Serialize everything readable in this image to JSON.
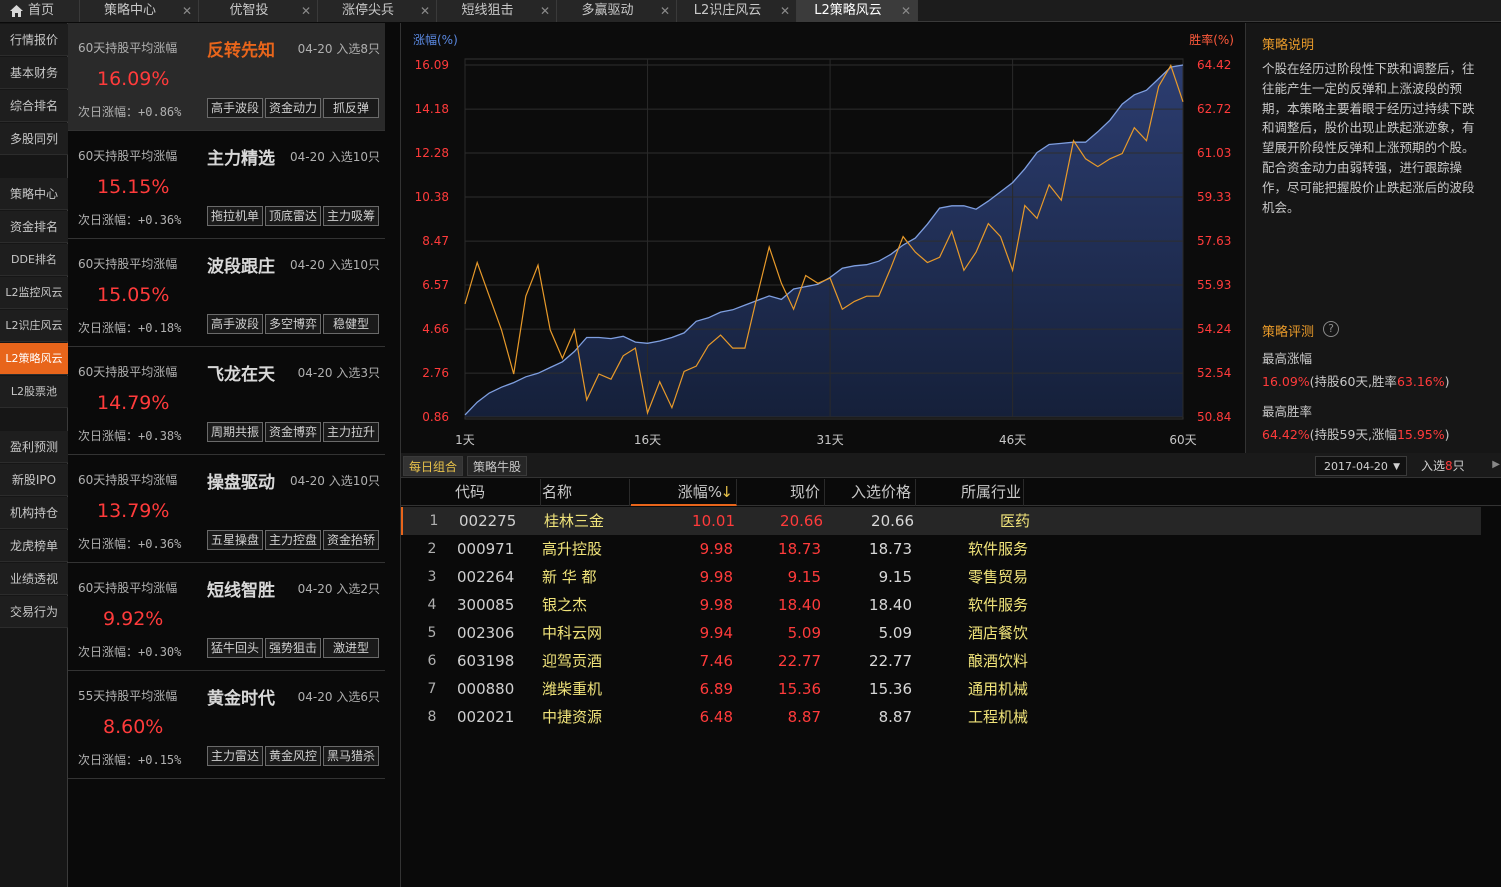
{
  "tabs": [
    {
      "label": "首页",
      "closable": false,
      "active": false
    },
    {
      "label": "策略中心",
      "closable": true,
      "active": false
    },
    {
      "label": "优智投",
      "closable": true,
      "active": false
    },
    {
      "label": "涨停尖兵",
      "closable": true,
      "active": false
    },
    {
      "label": "短线狙击",
      "closable": true,
      "active": false
    },
    {
      "label": "多赢驱动",
      "closable": true,
      "active": false
    },
    {
      "label": "L2识庄风云",
      "closable": true,
      "active": false
    },
    {
      "label": "L2策略风云",
      "closable": true,
      "active": true
    }
  ],
  "close_glyph": "✕",
  "leftnav": [
    {
      "label": "行情报价"
    },
    {
      "label": "基本财务"
    },
    {
      "label": "综合排名"
    },
    {
      "label": "多股同列"
    },
    {
      "label": "策略中心"
    },
    {
      "label": "资金排名"
    },
    {
      "label": "DDE排名"
    },
    {
      "label": "L2监控风云"
    },
    {
      "label": "L2识庄风云"
    },
    {
      "label": "L2策略风云",
      "active": true
    },
    {
      "label": "L2股票池"
    },
    {
      "label": "盈利预测"
    },
    {
      "label": "新股IPO"
    },
    {
      "label": "机构持仓"
    },
    {
      "label": "龙虎榜单"
    },
    {
      "label": "业绩透视"
    },
    {
      "label": "交易行为"
    }
  ],
  "strategies": [
    {
      "avg_label": "60天持股平均涨幅",
      "name": "反转先知",
      "date": "04-20",
      "selected_label": "入选8只",
      "avg_pct": "16.09%",
      "next_label": "次日涨幅：",
      "next_value": "+0.86%",
      "tags": [
        "高手波段",
        "资金动力",
        "抓反弹"
      ],
      "selected": true
    },
    {
      "avg_label": "60天持股平均涨幅",
      "name": "主力精选",
      "date": "04-20",
      "selected_label": "入选10只",
      "avg_pct": "15.15%",
      "next_label": "次日涨幅：",
      "next_value": "+0.36%",
      "tags": [
        "拖拉机单",
        "顶底雷达",
        "主力吸筹"
      ]
    },
    {
      "avg_label": "60天持股平均涨幅",
      "name": "波段跟庄",
      "date": "04-20",
      "selected_label": "入选10只",
      "avg_pct": "15.05%",
      "next_label": "次日涨幅：",
      "next_value": "+0.18%",
      "tags": [
        "高手波段",
        "多空博弈",
        "稳健型"
      ]
    },
    {
      "avg_label": "60天持股平均涨幅",
      "name": "飞龙在天",
      "date": "04-20",
      "selected_label": "入选3只",
      "avg_pct": "14.79%",
      "next_label": "次日涨幅：",
      "next_value": "+0.38%",
      "tags": [
        "周期共振",
        "资金博弈",
        "主力拉升"
      ]
    },
    {
      "avg_label": "60天持股平均涨幅",
      "name": "操盘驱动",
      "date": "04-20",
      "selected_label": "入选10只",
      "avg_pct": "13.79%",
      "next_label": "次日涨幅：",
      "next_value": "+0.36%",
      "tags": [
        "五星操盘",
        "主力控盘",
        "资金抬轿"
      ]
    },
    {
      "avg_label": "60天持股平均涨幅",
      "name": "短线智胜",
      "date": "04-20",
      "selected_label": "入选2只",
      "avg_pct": "9.92%",
      "next_label": "次日涨幅：",
      "next_value": "+0.30%",
      "tags": [
        "猛牛回头",
        "强势狙击",
        "激进型"
      ]
    },
    {
      "avg_label": "55天持股平均涨幅",
      "name": "黄金时代",
      "date": "04-20",
      "selected_label": "入选6只",
      "avg_pct": "8.60%",
      "next_label": "次日涨幅：",
      "next_value": "+0.15%",
      "tags": [
        "主力雷达",
        "黄金风控",
        "黑马猎杀"
      ]
    }
  ],
  "chart_data": {
    "type": "line",
    "y_left_label": "涨幅(%)",
    "y_right_label": "胜率(%)",
    "y_left_ticks": [
      "16.09",
      "14.18",
      "12.28",
      "10.38",
      "8.47",
      "6.57",
      "4.66",
      "2.76",
      "0.86"
    ],
    "y_right_ticks": [
      "64.42",
      "62.72",
      "61.03",
      "59.33",
      "57.63",
      "55.93",
      "54.24",
      "52.54",
      "50.84"
    ],
    "y_left_range": [
      0.86,
      16.09
    ],
    "y_right_range": [
      50.84,
      64.42
    ],
    "x_ticks": [
      "1天",
      "16天",
      "31天",
      "46天",
      "60天"
    ],
    "x_tick_days": [
      1,
      16,
      31,
      46,
      60
    ],
    "x": [
      1,
      2,
      3,
      4,
      5,
      6,
      7,
      8,
      9,
      10,
      11,
      12,
      13,
      14,
      15,
      16,
      17,
      18,
      19,
      20,
      21,
      22,
      23,
      24,
      25,
      26,
      27,
      28,
      29,
      30,
      31,
      32,
      33,
      34,
      35,
      36,
      37,
      38,
      39,
      40,
      41,
      42,
      43,
      44,
      45,
      46,
      47,
      48,
      49,
      50,
      51,
      52,
      53,
      54,
      55,
      56,
      57,
      58,
      59,
      60
    ],
    "series": [
      {
        "name": "涨幅(%)",
        "axis": "left",
        "color": "#7f9fe0",
        "fill": "#24325a",
        "values": [
          0.95,
          1.5,
          1.9,
          2.15,
          2.35,
          2.6,
          2.75,
          3.0,
          3.25,
          3.7,
          4.3,
          4.3,
          4.25,
          4.35,
          4.1,
          4.05,
          4.15,
          4.3,
          4.5,
          5.0,
          5.15,
          5.4,
          5.5,
          5.7,
          5.9,
          6.1,
          5.95,
          6.4,
          6.5,
          6.6,
          6.9,
          7.3,
          7.4,
          7.45,
          7.6,
          7.9,
          8.3,
          8.6,
          9.2,
          9.9,
          10.0,
          10.0,
          9.85,
          10.2,
          10.6,
          11.0,
          11.6,
          12.3,
          12.65,
          12.7,
          12.75,
          12.75,
          13.2,
          13.7,
          14.4,
          14.8,
          15.0,
          15.5,
          16.0,
          16.09
        ]
      },
      {
        "name": "胜率(%)",
        "axis": "right",
        "color": "#e89a2a",
        "values": [
          55.2,
          56.8,
          55.5,
          54.2,
          52.5,
          55.5,
          56.7,
          54.2,
          53.1,
          54.2,
          51.5,
          52.5,
          52.3,
          53.2,
          53.5,
          51.0,
          52.2,
          51.2,
          52.6,
          52.8,
          53.6,
          54.0,
          53.5,
          53.5,
          55.5,
          57.4,
          56.0,
          55.0,
          56.3,
          56.0,
          56.2,
          55.0,
          55.3,
          55.5,
          55.5,
          56.6,
          57.8,
          57.2,
          56.8,
          57.0,
          58.0,
          56.5,
          57.2,
          58.3,
          57.8,
          56.5,
          59.0,
          58.5,
          59.8,
          59.2,
          61.5,
          60.8,
          60.5,
          60.8,
          61.0,
          62.0,
          61.5,
          63.6,
          64.4,
          63.0
        ]
      }
    ]
  },
  "description": {
    "title": "策略说明",
    "text": "个股在经历过阶段性下跌和调整后，往往能产生一定的反弹和上涨波段的预期，本策略主要着眼于经历过持续下跌和调整后，股价出现止跌起涨迹象，有望展开阶段性反弹和上涨预期的个股。配合资金动力由弱转强，进行跟踪操作，尽可能把握股价止跌起涨后的波段机会。",
    "eval_title": "策略评测",
    "max_return_label": "最高涨幅",
    "max_return_value": "16.09%",
    "max_return_detail_a": "(持股60天,胜率",
    "max_return_winrate": "63.16%",
    "max_return_detail_b": ")",
    "max_win_label": "最高胜率",
    "max_win_value": "64.42%",
    "max_win_detail_a": "(持股59天,涨幅",
    "max_win_return": "15.95%",
    "max_win_detail_b": ")"
  },
  "bottom_tabs": [
    {
      "label": "每日组合",
      "active": true
    },
    {
      "label": "策略牛股",
      "active": false
    }
  ],
  "date_select": "2017-04-20",
  "selected_count": {
    "prefix": "入选",
    "count": "8",
    "suffix": "只"
  },
  "table": {
    "headers": [
      "代码",
      "名称",
      "涨幅%",
      "现价",
      "入选价格",
      "所属行业"
    ],
    "sort_arrow": "↓",
    "rows": [
      {
        "idx": "1",
        "code": "002275",
        "name": "桂林三金",
        "chg": "10.01",
        "price": "20.66",
        "entry": "20.66",
        "industry": "医药",
        "selected": true
      },
      {
        "idx": "2",
        "code": "000971",
        "name": "高升控股",
        "chg": "9.98",
        "price": "18.73",
        "entry": "18.73",
        "industry": "软件服务"
      },
      {
        "idx": "3",
        "code": "002264",
        "name": "新 华 都",
        "chg": "9.98",
        "price": "9.15",
        "entry": "9.15",
        "industry": "零售贸易"
      },
      {
        "idx": "4",
        "code": "300085",
        "name": "银之杰",
        "chg": "9.98",
        "price": "18.40",
        "entry": "18.40",
        "industry": "软件服务"
      },
      {
        "idx": "5",
        "code": "002306",
        "name": "中科云网",
        "chg": "9.94",
        "price": "5.09",
        "entry": "5.09",
        "industry": "酒店餐饮"
      },
      {
        "idx": "6",
        "code": "603198",
        "name": "迎驾贡酒",
        "chg": "7.46",
        "price": "22.77",
        "entry": "22.77",
        "industry": "酿酒饮料"
      },
      {
        "idx": "7",
        "code": "000880",
        "name": "潍柴重机",
        "chg": "6.89",
        "price": "15.36",
        "entry": "15.36",
        "industry": "通用机械"
      },
      {
        "idx": "8",
        "code": "002021",
        "name": "中捷资源",
        "chg": "6.48",
        "price": "8.87",
        "entry": "8.87",
        "industry": "工程机械"
      }
    ]
  }
}
